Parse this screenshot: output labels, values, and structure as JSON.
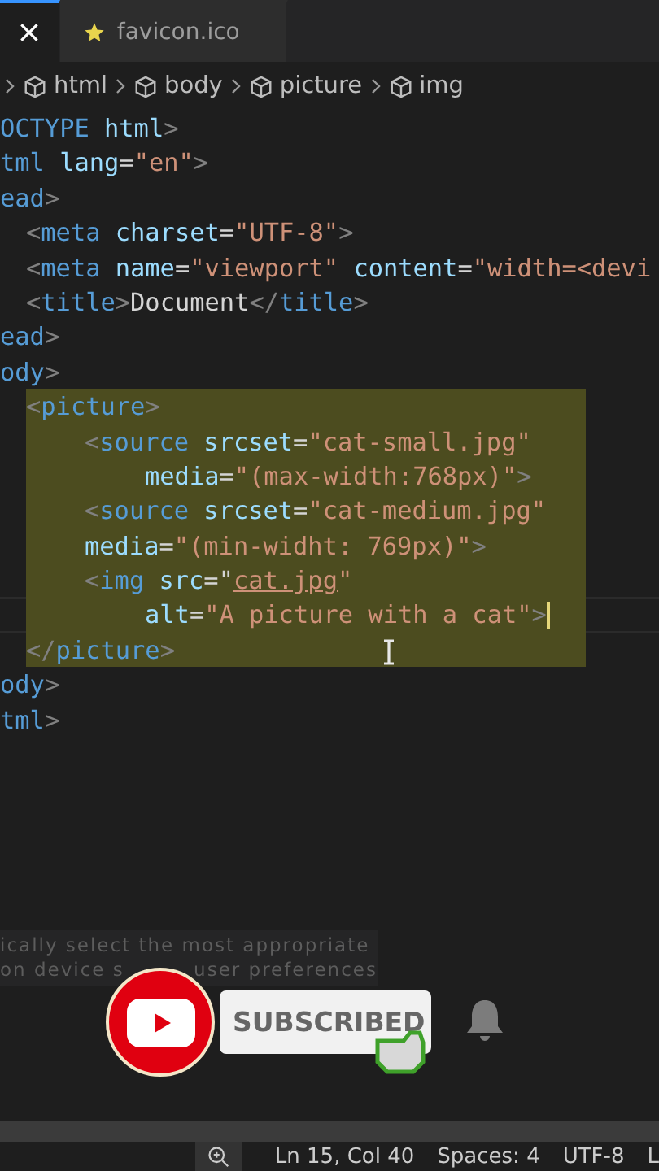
{
  "tabs": [
    {
      "label": "×",
      "kind": "close",
      "selected": true
    },
    {
      "label": "favicon.ico",
      "kind": "file",
      "selected": false
    }
  ],
  "breadcrumbs": [
    "html",
    "body",
    "picture",
    "img"
  ],
  "code_lines": [
    {
      "kind": "flush",
      "selected": false,
      "cursor": false,
      "tokens": [
        {
          "kind": "tag",
          "text": "OCTYPE"
        },
        {
          "kind": "attr",
          "text": " html"
        },
        {
          "kind": "punct",
          "text": ">"
        }
      ]
    },
    {
      "kind": "flush",
      "selected": false,
      "cursor": false,
      "tokens": [
        {
          "kind": "tag",
          "text": "tml"
        },
        {
          "kind": "attr",
          "text": " lang"
        },
        {
          "kind": "plain",
          "text": "="
        },
        {
          "kind": "string",
          "text": "\"en\""
        },
        {
          "kind": "punct",
          "text": ">"
        }
      ]
    },
    {
      "kind": "flush",
      "selected": false,
      "cursor": false,
      "tokens": [
        {
          "kind": "tag",
          "text": "ead"
        },
        {
          "kind": "punct",
          "text": ">"
        }
      ]
    },
    {
      "kind": "nested",
      "selected": false,
      "cursor": false,
      "tokens": [
        {
          "kind": "punct",
          "text": "<"
        },
        {
          "kind": "tag",
          "text": "meta"
        },
        {
          "kind": "attr",
          "text": " charset"
        },
        {
          "kind": "plain",
          "text": "="
        },
        {
          "kind": "string",
          "text": "\"UTF-8\""
        },
        {
          "kind": "punct",
          "text": ">"
        }
      ]
    },
    {
      "kind": "nested",
      "selected": false,
      "cursor": false,
      "tokens": [
        {
          "kind": "punct",
          "text": "<"
        },
        {
          "kind": "tag",
          "text": "meta"
        },
        {
          "kind": "attr",
          "text": " name"
        },
        {
          "kind": "plain",
          "text": "="
        },
        {
          "kind": "string",
          "text": "\"viewport\""
        },
        {
          "kind": "attr",
          "text": " content"
        },
        {
          "kind": "plain",
          "text": "="
        },
        {
          "kind": "string",
          "text": "\"width=<devi"
        }
      ]
    },
    {
      "kind": "nested",
      "selected": false,
      "cursor": false,
      "tokens": [
        {
          "kind": "punct",
          "text": "<"
        },
        {
          "kind": "tag",
          "text": "title"
        },
        {
          "kind": "punct",
          "text": ">"
        },
        {
          "kind": "plain",
          "text": "Document"
        },
        {
          "kind": "punct",
          "text": "</"
        },
        {
          "kind": "tag",
          "text": "title"
        },
        {
          "kind": "punct",
          "text": ">"
        }
      ]
    },
    {
      "kind": "flush",
      "selected": false,
      "cursor": false,
      "tokens": [
        {
          "kind": "tag",
          "text": "ead"
        },
        {
          "kind": "punct",
          "text": ">"
        }
      ]
    },
    {
      "kind": "flush",
      "selected": false,
      "cursor": false,
      "tokens": [
        {
          "kind": "tag",
          "text": "ody"
        },
        {
          "kind": "punct",
          "text": ">"
        }
      ]
    },
    {
      "kind": "nested",
      "selected": true,
      "cursor": false,
      "tokens": [
        {
          "kind": "punct",
          "text": "<"
        },
        {
          "kind": "tag",
          "text": "picture"
        },
        {
          "kind": "punct",
          "text": ">"
        }
      ]
    },
    {
      "kind": "deep",
      "selected": true,
      "cursor": false,
      "tokens": [
        {
          "kind": "punct",
          "text": "<"
        },
        {
          "kind": "tag",
          "text": "source"
        },
        {
          "kind": "attr",
          "text": " srcset"
        },
        {
          "kind": "plain",
          "text": "="
        },
        {
          "kind": "string",
          "text": "\"cat-small.jpg\""
        }
      ]
    },
    {
      "kind": "deeper",
      "selected": true,
      "cursor": false,
      "tokens": [
        {
          "kind": "attr",
          "text": "media"
        },
        {
          "kind": "plain",
          "text": "="
        },
        {
          "kind": "string",
          "text": "\"(max-width:768px)\""
        },
        {
          "kind": "punct",
          "text": ">"
        }
      ]
    },
    {
      "kind": "deep",
      "selected": true,
      "cursor": false,
      "tokens": [
        {
          "kind": "punct",
          "text": "<"
        },
        {
          "kind": "tag",
          "text": "source"
        },
        {
          "kind": "attr",
          "text": " srcset"
        },
        {
          "kind": "plain",
          "text": "="
        },
        {
          "kind": "string",
          "text": "\"cat-medium.jpg\""
        }
      ]
    },
    {
      "kind": "deep",
      "selected": true,
      "cursor": false,
      "tokens": [
        {
          "kind": "attr",
          "text": "media"
        },
        {
          "kind": "plain",
          "text": "="
        },
        {
          "kind": "string",
          "text": "\"(min-widht: 769px)\""
        },
        {
          "kind": "punct",
          "text": ">"
        }
      ]
    },
    {
      "kind": "deep",
      "selected": true,
      "cursor": false,
      "tokens": [
        {
          "kind": "punct",
          "text": "<"
        },
        {
          "kind": "tag",
          "text": "img"
        },
        {
          "kind": "attr",
          "text": " src"
        },
        {
          "kind": "plain",
          "text": "=\""
        },
        {
          "kind": "link",
          "text": "cat.jpg"
        },
        {
          "kind": "string",
          "text": "\""
        }
      ]
    },
    {
      "kind": "deeper",
      "selected": true,
      "cursor": true,
      "tokens": [
        {
          "kind": "attr",
          "text": "alt"
        },
        {
          "kind": "plain",
          "text": "="
        },
        {
          "kind": "string",
          "text": "\"A picture with a cat\""
        },
        {
          "kind": "punct",
          "text": ">"
        }
      ]
    },
    {
      "kind": "nested",
      "selected": true,
      "cursor": false,
      "tokens": [
        {
          "kind": "punct",
          "text": "</"
        },
        {
          "kind": "tag",
          "text": "picture"
        },
        {
          "kind": "punct",
          "text": ">"
        }
      ]
    },
    {
      "kind": "flush",
      "selected": false,
      "cursor": false,
      "tokens": [
        {
          "kind": "tag",
          "text": "ody"
        },
        {
          "kind": "punct",
          "text": ">"
        }
      ]
    },
    {
      "kind": "flush",
      "selected": false,
      "cursor": false,
      "tokens": [
        {
          "kind": "tag",
          "text": "tml"
        },
        {
          "kind": "punct",
          "text": ">"
        }
      ]
    }
  ],
  "hover_tip": {
    "line_1": "ically select the most appropriate",
    "line_2_start": "on device s",
    "line_2_end": "user preferences"
  },
  "subscribe": {
    "label": "SUBSCRIBED"
  },
  "status_bar": [
    "Ln 15, Col 40",
    "Spaces: 4",
    "UTF-8",
    "L"
  ]
}
